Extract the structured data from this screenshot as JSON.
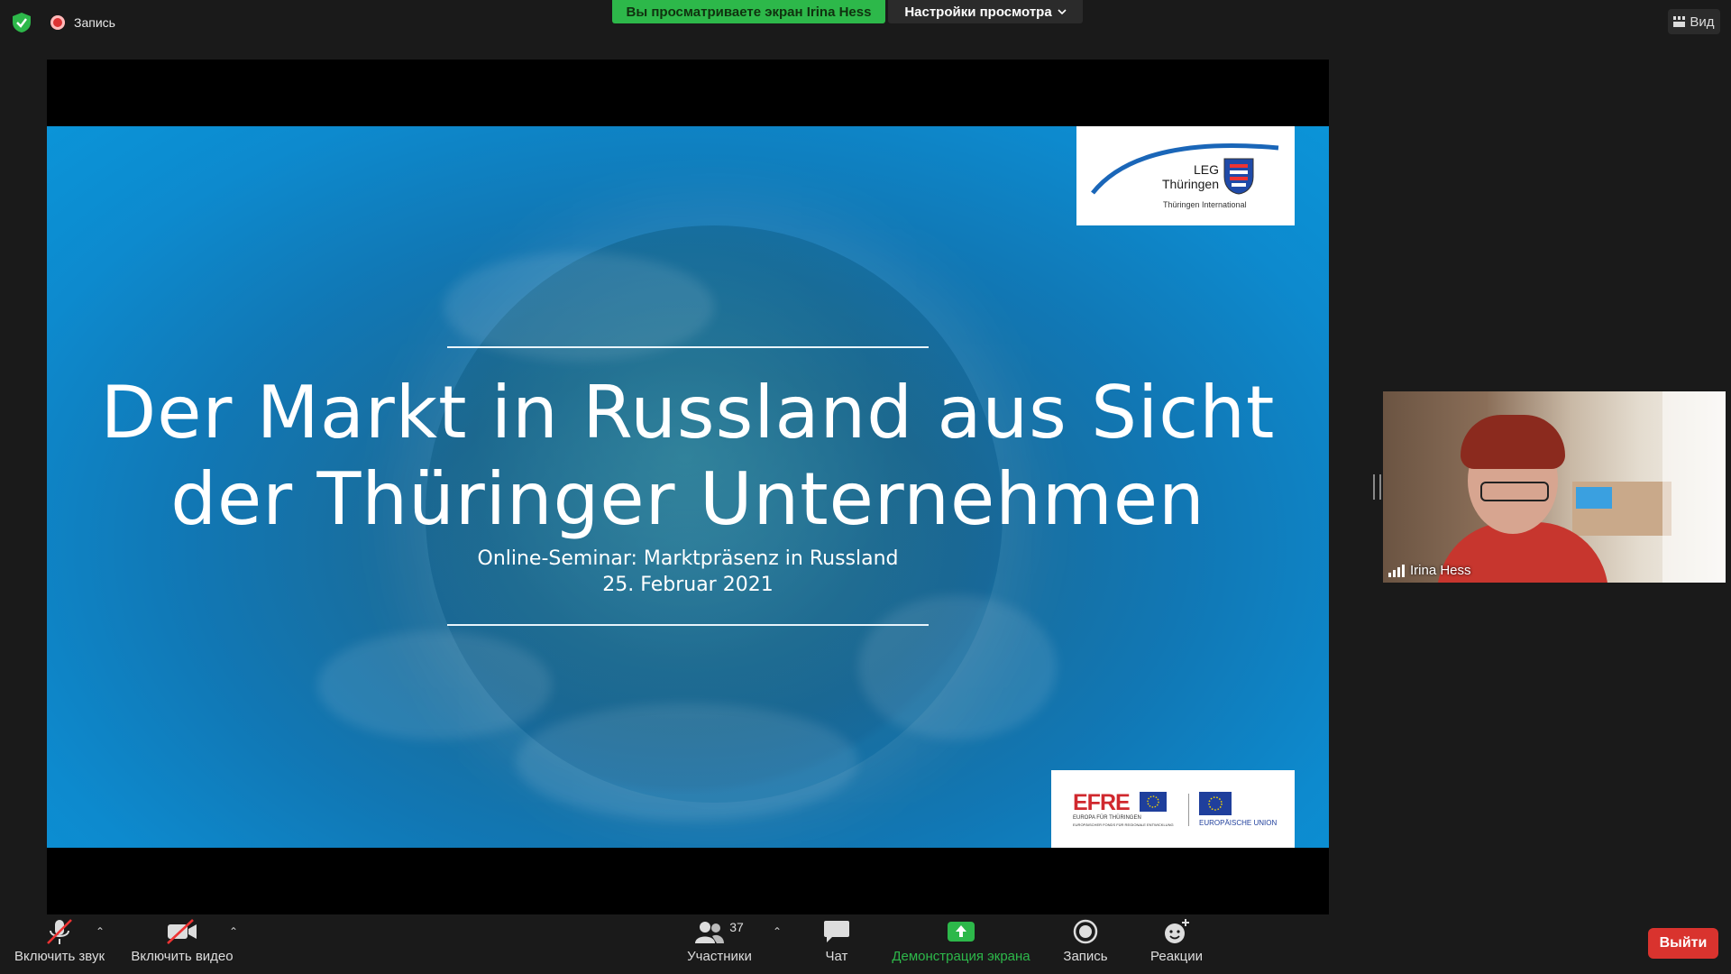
{
  "top_bar": {
    "recording_label": "Запись",
    "share_banner": "Вы просматриваете экран Irina Hess",
    "view_settings": "Настройки просмотра",
    "view_button": "Вид"
  },
  "slide": {
    "title_line1": "Der Markt in Russland aus Sicht",
    "title_line2": "der Thüringer Unternehmen",
    "subtitle_line1": "Online-Seminar: Marktpräsenz in Russland",
    "subtitle_line2": "25. Februar 2021",
    "leg_logo": {
      "line1": "LEG",
      "line2": "Thüringen",
      "sub": "Thüringen International"
    },
    "efre_logo": {
      "name": "EFRE",
      "line1": "EUROPA FÜR THÜRINGEN",
      "line2": "EUROPÄISCHER FONDS FÜR REGIONALE ENTWICKLUNG",
      "eu_label": "EUROPÄISCHE UNION"
    }
  },
  "participant": {
    "name": "Irina Hess"
  },
  "toolbar": {
    "unmute_label": "Включить звук",
    "start_video_label": "Включить видео",
    "participants_label": "Участники",
    "participants_count": "37",
    "chat_label": "Чат",
    "share_screen_label": "Демонстрация экрана",
    "record_label": "Запись",
    "reactions_label": "Реакции",
    "leave_label": "Выйти"
  },
  "colors": {
    "share_green": "#2db84a",
    "leave_red": "#d9332e",
    "efre_red": "#d0282e",
    "eu_blue": "#1f3f9c"
  }
}
